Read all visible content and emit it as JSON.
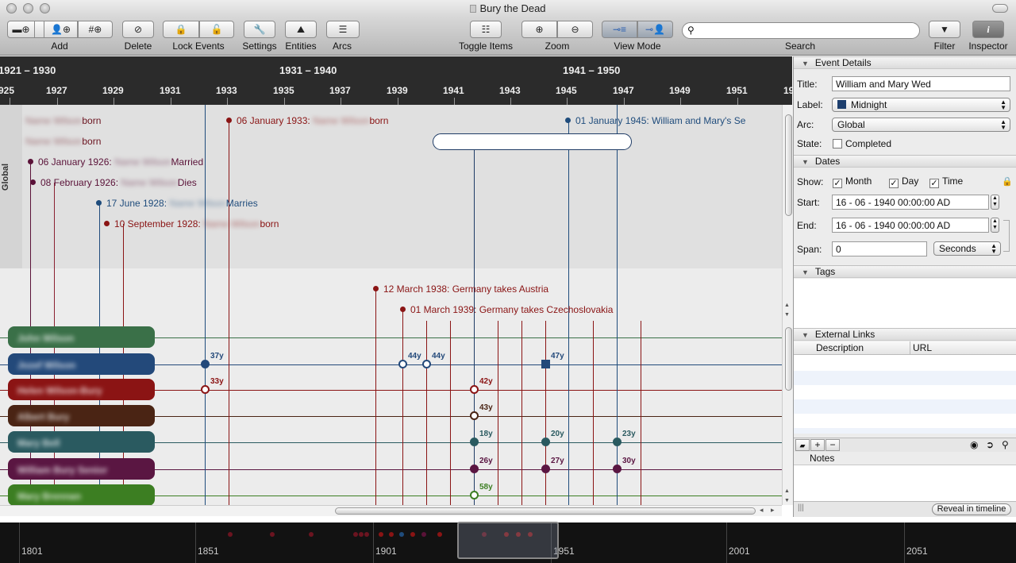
{
  "window": {
    "title": "Bury the Dead"
  },
  "toolbar": {
    "add_label": "Add",
    "delete_label": "Delete",
    "lock_events_label": "Lock Events",
    "settings_label": "Settings",
    "entities_label": "Entities",
    "arcs_label": "Arcs",
    "toggle_items_label": "Toggle Items",
    "zoom_label": "Zoom",
    "view_mode_label": "View Mode",
    "search_label": "Search",
    "search_placeholder": "",
    "filter_label": "Filter",
    "inspector_label": "Inspector"
  },
  "timescale": {
    "decades": [
      "1921 – 1930",
      "1931 – 1940",
      "1941 – 1950"
    ],
    "years": [
      "925",
      "1927",
      "1929",
      "1931",
      "1933",
      "1935",
      "1937",
      "1939",
      "1941",
      "1943",
      "1945",
      "1947",
      "1949",
      "1951",
      "19"
    ]
  },
  "arc_label": "Global",
  "events": [
    {
      "date": "",
      "text": "born",
      "color": "#6b1420"
    },
    {
      "date": "",
      "text": "born",
      "color": "#6b1420"
    },
    {
      "date": "06 January 1926:",
      "text": "Married",
      "color": "#5a1238"
    },
    {
      "date": "08 February 1926:",
      "text": "Dies",
      "color": "#5a1238"
    },
    {
      "date": "17 June 1928:",
      "text": "Marries",
      "color": "#1f4c7c"
    },
    {
      "date": "10 September 1928:",
      "text": "born",
      "color": "#8a1414"
    },
    {
      "date": "06 January 1933:",
      "text": "born",
      "color": "#8a1414"
    },
    {
      "date": "01 January 1945:",
      "text": "William and Mary's Se",
      "color": "#1f4c7c"
    },
    {
      "date": "16 June 1940:",
      "text": "William and Mary Wed",
      "color": "#1f3c66"
    },
    {
      "date": "12 March 1938:",
      "text": "Germany takes Austria",
      "color": "#8a1414"
    },
    {
      "date": "01 March 1939:",
      "text": "Germany takes Czechoslovakia",
      "color": "#8a1414"
    }
  ],
  "entities": [
    {
      "name": "John Wilson",
      "color": "#3a7048"
    },
    {
      "name": "Jozef Wilson",
      "color": "#23497a"
    },
    {
      "name": "Helen Wilson-Bury",
      "color": "#8b1414"
    },
    {
      "name": "Albert Bury",
      "color": "#4a2414"
    },
    {
      "name": "Mary Bell",
      "color": "#2a5a60"
    },
    {
      "name": "William Bury Senior",
      "color": "#5a1642"
    },
    {
      "name": "Mary Brennan",
      "color": "#3c7e22"
    }
  ],
  "age_markers": [
    "37y",
    "44y",
    "44y",
    "47y",
    "33y",
    "42y",
    "43y",
    "18y",
    "20y",
    "23y",
    "26y",
    "27y",
    "30y",
    "58y"
  ],
  "overview": {
    "years": [
      "1801",
      "1851",
      "1901",
      "1951",
      "2001",
      "2051"
    ]
  },
  "inspector": {
    "event_details_header": "Event Details",
    "title_label": "Title:",
    "title_value": "William and Mary Wed",
    "label_label": "Label:",
    "label_value": "Midnight",
    "label_color": "#1d3f6e",
    "arc_label": "Arc:",
    "arc_value": "Global",
    "state_label": "State:",
    "completed_label": "Completed",
    "dates_header": "Dates",
    "show_label": "Show:",
    "month_label": "Month",
    "day_label": "Day",
    "time_label": "Time",
    "start_label": "Start:",
    "start_value": "16 - 06 - 1940   00:00:00 AD",
    "end_label": "End:",
    "end_value": "16 - 06 - 1940   00:00:00 AD",
    "span_label": "Span:",
    "span_value": "0",
    "span_unit": "Seconds",
    "tags_header": "Tags",
    "links_header": "External Links",
    "col_description": "Description",
    "col_url": "URL",
    "notes_header": "Notes",
    "reveal_label": "Reveal in timeline"
  }
}
